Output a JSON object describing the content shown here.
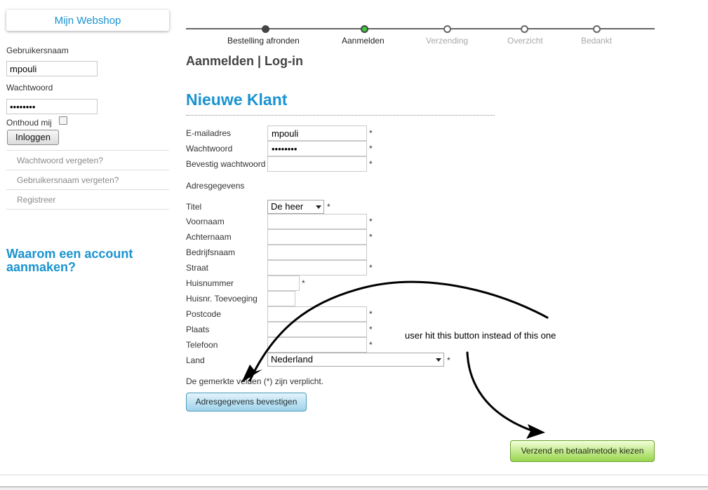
{
  "sidebar": {
    "shop_title": "Mijn Webshop",
    "username_label": "Gebruikersnaam",
    "username_value": "mpouli",
    "password_label": "Wachtwoord",
    "password_value": "••••••••",
    "remember_label": "Onthoud mij",
    "remember_checked": false,
    "login_button": "Inloggen",
    "links": [
      "Wachtwoord vergeten?",
      "Gebruikersnaam vergeten?",
      "Registreer"
    ],
    "why_title": "Waarom een account aanmaken?"
  },
  "steps": [
    {
      "label": "Bestelling afronden",
      "state": "done"
    },
    {
      "label": "Aanmelden",
      "state": "active"
    },
    {
      "label": "Verzending",
      "state": "future"
    },
    {
      "label": "Overzicht",
      "state": "future"
    },
    {
      "label": "Bedankt",
      "state": "future"
    }
  ],
  "main": {
    "page_title": "Aanmelden | Log-in",
    "section_title": "Nieuwe Klant",
    "account": {
      "email_label": "E-mailadres",
      "email_value": "mpouli",
      "password_label": "Wachtwoord",
      "password_value": "••••••••",
      "confirm_label": "Bevestig wachtwoord",
      "confirm_value": ""
    },
    "address_heading": "Adresgegevens",
    "address": {
      "title_label": "Titel",
      "title_value": "De heer",
      "firstname_label": "Voornaam",
      "lastname_label": "Achternaam",
      "company_label": "Bedrijfsnaam",
      "street_label": "Straat",
      "housenr_label": "Huisnummer",
      "housenr_add_label": "Huisnr. Toevoeging",
      "postcode_label": "Postcode",
      "city_label": "Plaats",
      "phone_label": "Telefoon",
      "country_label": "Land",
      "country_value": "Nederland"
    },
    "required_mark": "*",
    "required_note": "De gemerkte velden (*) zijn verplicht.",
    "confirm_button": "Adresgegevens bevestigen",
    "ship_button": "Verzend en betaalmetode kiezen"
  },
  "annotation": {
    "text": "user hit this button instead of this one"
  }
}
